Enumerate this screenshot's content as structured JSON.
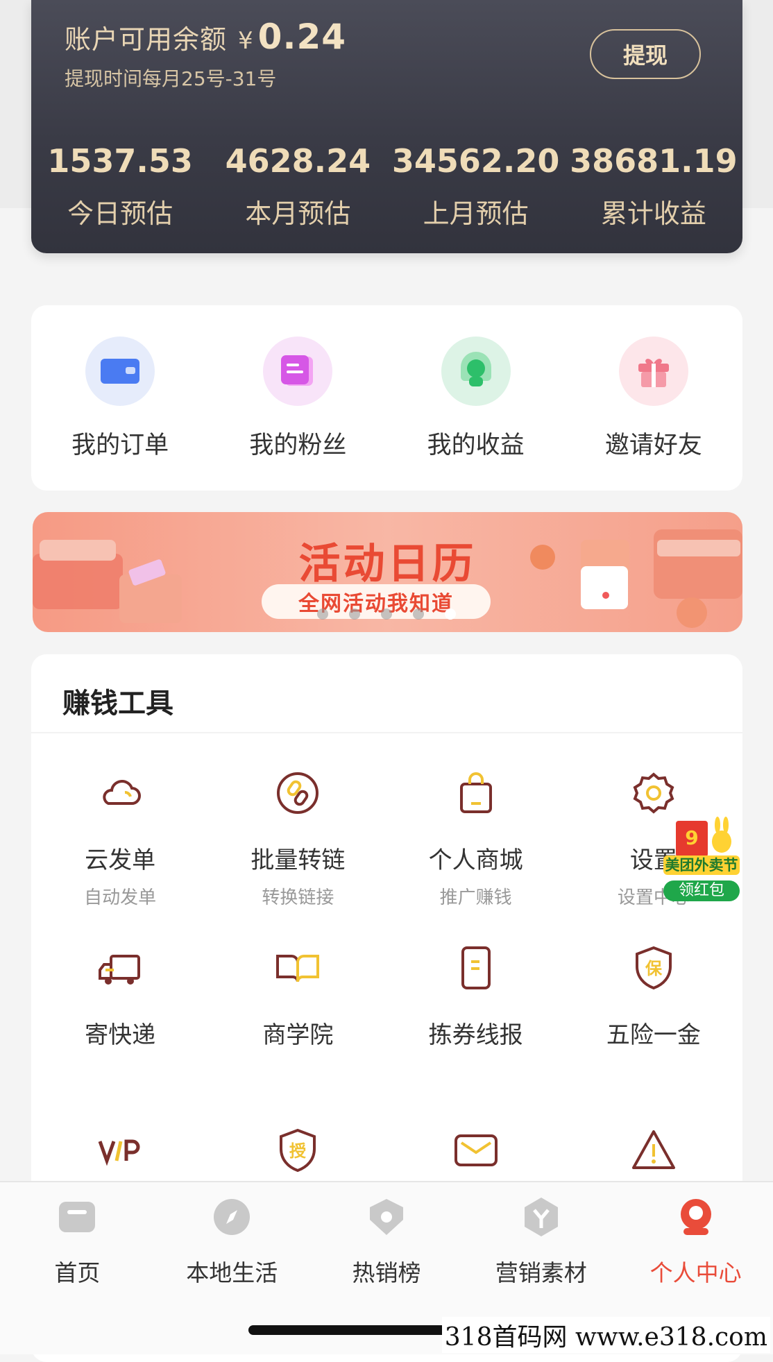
{
  "balance": {
    "title": "账户可用余额",
    "currency": "¥",
    "amount": "0.24",
    "subtitle": "提现时间每月25号-31号",
    "withdraw_label": "提现",
    "stats": [
      {
        "value": "1537.53",
        "label": "今日预估"
      },
      {
        "value": "4628.24",
        "label": "本月预估"
      },
      {
        "value": "34562.20",
        "label": "上月预估"
      },
      {
        "value": "38681.19",
        "label": "累计收益"
      }
    ]
  },
  "quick": [
    {
      "label": "我的订单",
      "icon": "wallet-icon",
      "color": "#4a7bf2"
    },
    {
      "label": "我的粉丝",
      "icon": "fans-icon",
      "color": "#d657e6"
    },
    {
      "label": "我的收益",
      "icon": "earnings-icon",
      "color": "#2dbf6a"
    },
    {
      "label": "邀请好友",
      "icon": "gift-icon",
      "color": "#f0788a"
    }
  ],
  "banner": {
    "title": "活动日历",
    "pill": "全网活动我知道",
    "slides": 5,
    "active_slide": 5
  },
  "tools": {
    "title": "赚钱工具",
    "rows": [
      [
        {
          "name": "云发单",
          "sub": "自动发单",
          "icon": "cloud-icon"
        },
        {
          "name": "批量转链",
          "sub": "转换链接",
          "icon": "link-icon"
        },
        {
          "name": "个人商城",
          "sub": "推广赚钱",
          "icon": "shopping-bag-icon"
        },
        {
          "name": "设置",
          "sub": "设置中心",
          "icon": "gear-icon"
        }
      ],
      [
        {
          "name": "寄快递",
          "sub": "",
          "icon": "truck-icon"
        },
        {
          "name": "商学院",
          "sub": "",
          "icon": "book-icon"
        },
        {
          "name": "拣券线报",
          "sub": "",
          "icon": "note-icon"
        },
        {
          "name": "五险一金",
          "sub": "",
          "icon": "shield-icon"
        }
      ],
      [
        {
          "name": "",
          "sub": "",
          "icon": "vip-icon"
        },
        {
          "name": "",
          "sub": "",
          "icon": "authorize-icon"
        },
        {
          "name": "",
          "sub": "",
          "icon": "mail-icon"
        },
        {
          "name": "",
          "sub": "",
          "icon": "warning-icon"
        }
      ]
    ]
  },
  "float_badge": {
    "number": "9",
    "title": "美团外卖节",
    "action": "领红包"
  },
  "nav": [
    {
      "label": "首页",
      "icon": "home-icon",
      "active": false
    },
    {
      "label": "本地生活",
      "icon": "compass-icon",
      "active": false
    },
    {
      "label": "热销榜",
      "icon": "hot-icon",
      "active": false
    },
    {
      "label": "营销素材",
      "icon": "materials-icon",
      "active": false
    },
    {
      "label": "个人中心",
      "icon": "profile-icon",
      "active": true
    }
  ],
  "watermark": "318首码网  www.e318.com",
  "colors": {
    "accent": "#e94c3a",
    "gold": "#efdcb8",
    "card_dark": "#3a3b46",
    "tool_brown": "#7a2f2c",
    "tool_yellow": "#f1c232"
  }
}
